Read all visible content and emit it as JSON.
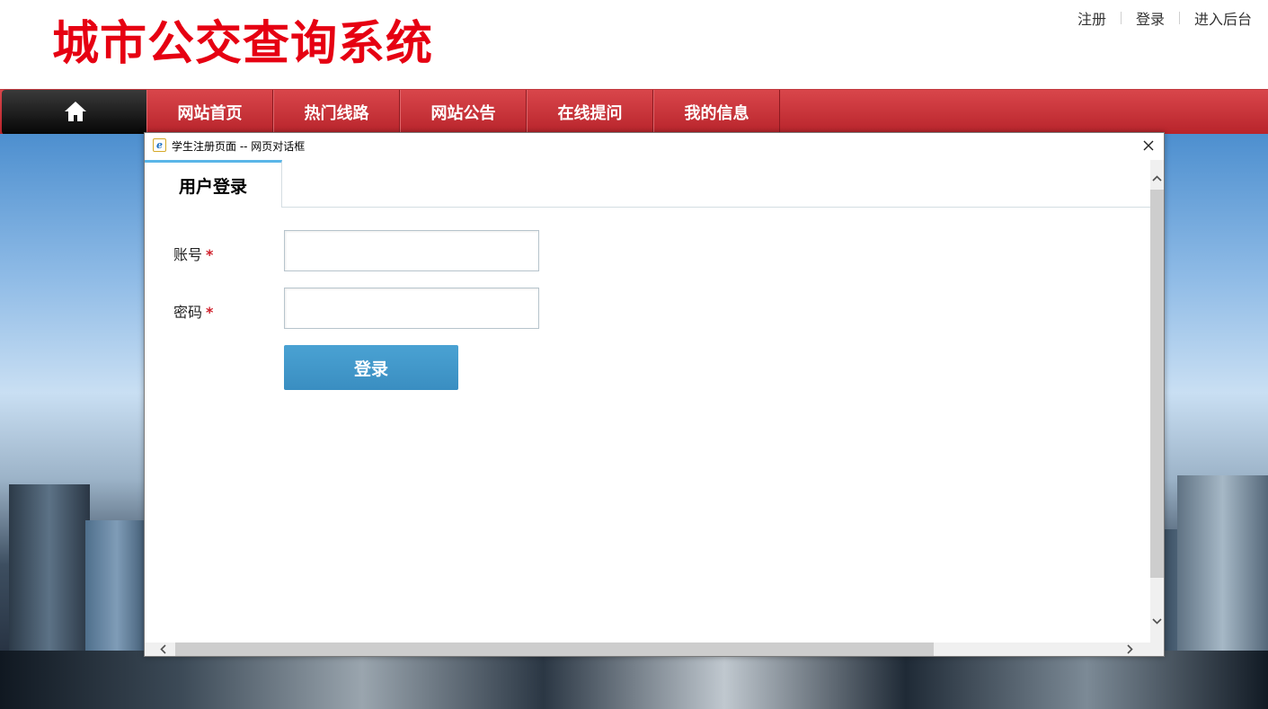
{
  "header": {
    "site_title": "城市公交查询系统",
    "links": [
      {
        "label": "注册"
      },
      {
        "label": "登录"
      },
      {
        "label": "进入后台"
      }
    ],
    "title_color": "#e60012"
  },
  "nav": {
    "home_icon": "home-icon",
    "items": [
      {
        "label": "网站首页"
      },
      {
        "label": "热门线路"
      },
      {
        "label": "网站公告"
      },
      {
        "label": "在线提问"
      },
      {
        "label": "我的信息"
      }
    ],
    "color": "#c0303a"
  },
  "dialog": {
    "title": "学生注册页面 -- 网页对话框",
    "icon": "ie-icon",
    "close_icon": "close-icon",
    "tab": {
      "label": "用户登录"
    },
    "form": {
      "account_label": "账号",
      "password_label": "密码",
      "required_mark": "*",
      "account_value": "",
      "password_value": "",
      "submit_label": "登录"
    },
    "accent_color": "#5ab6e8",
    "button_color": "#3f96c8"
  }
}
